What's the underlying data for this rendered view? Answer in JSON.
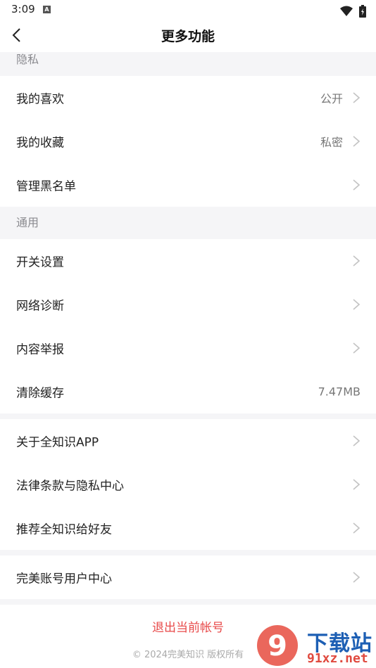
{
  "status_bar": {
    "time": "3:09",
    "notification_letter": "A"
  },
  "nav": {
    "title": "更多功能"
  },
  "sections": {
    "privacy": {
      "header": "隐私"
    },
    "general": {
      "header": "通用"
    }
  },
  "rows": {
    "likes": {
      "label": "我的喜欢",
      "value": "公开"
    },
    "favorites": {
      "label": "我的收藏",
      "value": "私密"
    },
    "blacklist": {
      "label": "管理黑名单"
    },
    "switch_settings": {
      "label": "开关设置"
    },
    "network_diagnosis": {
      "label": "网络诊断"
    },
    "content_report": {
      "label": "内容举报"
    },
    "clear_cache": {
      "label": "清除缓存",
      "value": "7.47MB"
    },
    "about": {
      "label": "关于全知识APP"
    },
    "legal": {
      "label": "法律条款与隐私中心"
    },
    "recommend": {
      "label": "推荐全知识给好友"
    },
    "account_center": {
      "label": "完美账号用户中心"
    }
  },
  "logout_label": "退出当前帐号",
  "copyright": "© 2024完美知识 版权所有",
  "watermark": {
    "text": "下载站",
    "url": "91xz.net",
    "logo_numeral": "9"
  },
  "colors": {
    "danger": "#e84a4a",
    "background": "#f5f5f7",
    "secondary_text": "#8a8a8f"
  }
}
